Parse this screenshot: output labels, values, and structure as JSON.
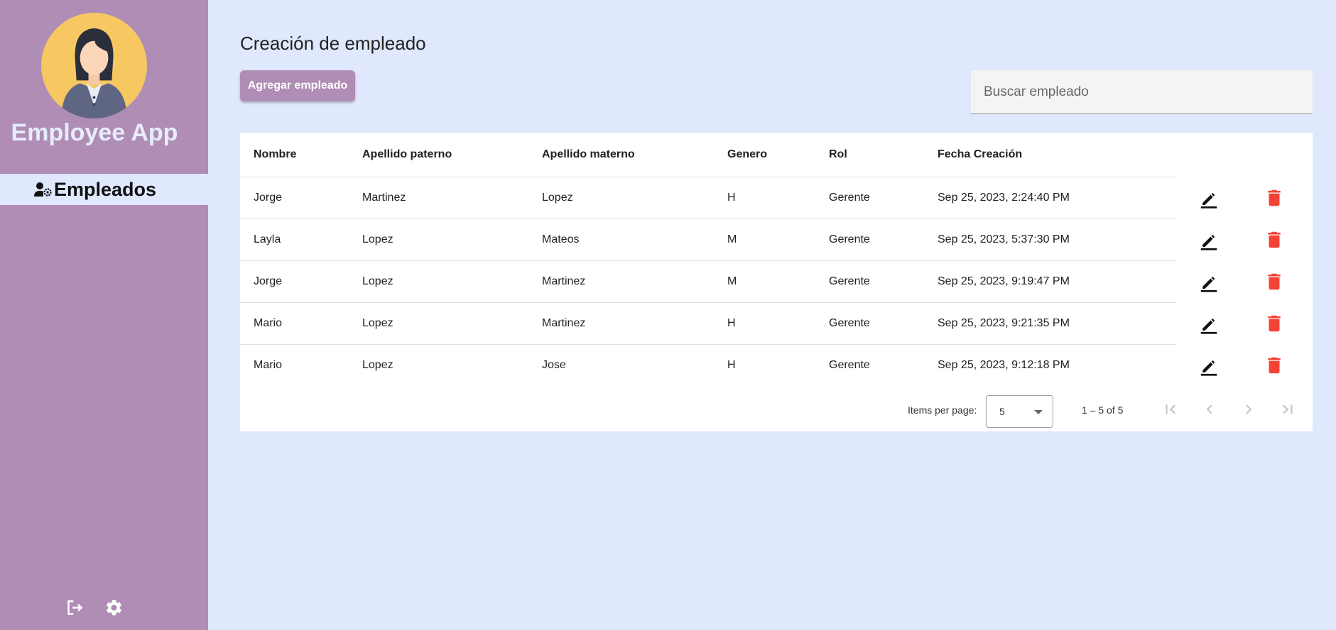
{
  "app": {
    "title": "Employee App"
  },
  "sidebar": {
    "nav": [
      {
        "label": "Empleados",
        "icon": "manage-accounts-icon"
      }
    ],
    "bottom_icons": [
      "logout-icon",
      "gear-icon"
    ]
  },
  "main": {
    "title": "Creación de empleado",
    "add_button": "Agregar empleado",
    "search": {
      "placeholder": "Buscar empleado",
      "value": ""
    }
  },
  "table": {
    "columns": [
      "Nombre",
      "Apellido paterno",
      "Apellido materno",
      "Genero",
      "Rol",
      "Fecha Creación"
    ],
    "rows": [
      [
        "Jorge",
        "Martinez",
        "Lopez",
        "H",
        "Gerente",
        "Sep 25, 2023, 2:24:40 PM"
      ],
      [
        "Layla",
        "Lopez",
        "Mateos",
        "M",
        "Gerente",
        "Sep 25, 2023, 5:37:30 PM"
      ],
      [
        "Jorge",
        "Lopez",
        "Martinez",
        "M",
        "Gerente",
        "Sep 25, 2023, 9:19:47 PM"
      ],
      [
        "Mario",
        "Lopez",
        "Martinez",
        "H",
        "Gerente",
        "Sep 25, 2023, 9:21:35 PM"
      ],
      [
        "Mario",
        "Lopez",
        "Jose",
        "H",
        "Gerente",
        "Sep 25, 2023, 9:12:18 PM"
      ]
    ],
    "row_actions": [
      "edit-icon",
      "delete-icon"
    ]
  },
  "paginator": {
    "items_per_page_label": "Items per page:",
    "page_size": "5",
    "range_label": "1 – 5 of 5"
  },
  "colors": {
    "sidebar": "#b08db5",
    "background": "#dfe8fc",
    "delete": "#f44336",
    "accent": "#b08db5"
  }
}
